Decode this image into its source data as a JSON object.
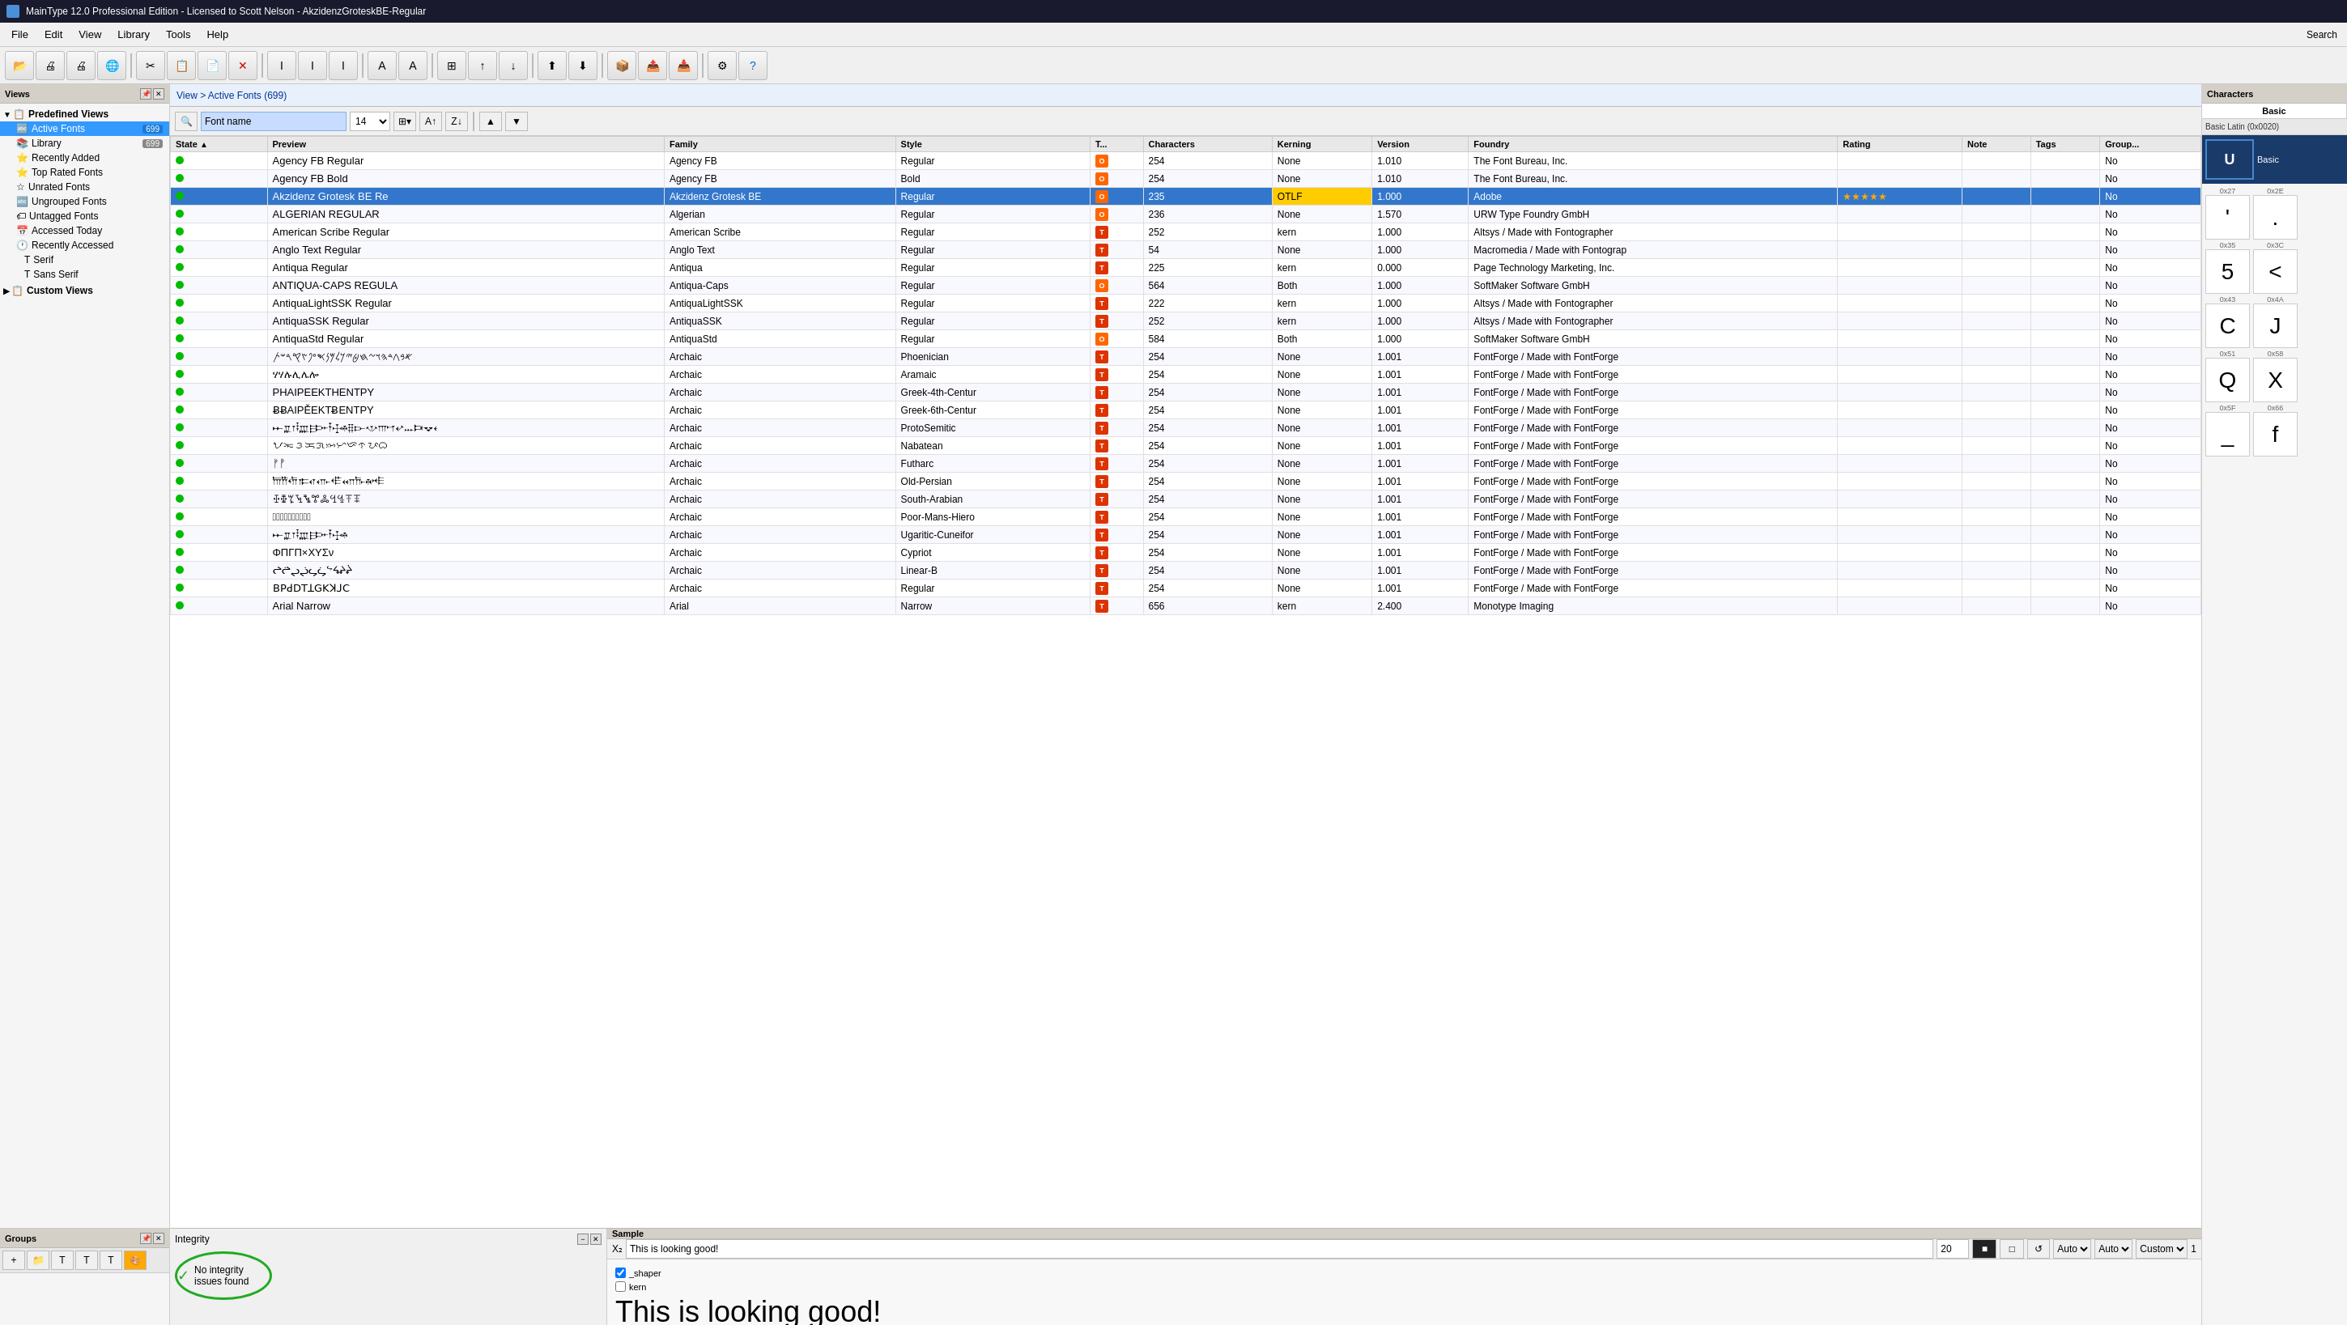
{
  "titleBar": {
    "text": "MainType 12.0 Professional Edition - Licensed to Scott Nelson - AkzidenzGroteskBE-Regular"
  },
  "menuBar": {
    "items": [
      "File",
      "Edit",
      "View",
      "Library",
      "Tools",
      "Help"
    ]
  },
  "toolbar": {
    "searchLabel": "Search"
  },
  "viewsPanel": {
    "title": "Views",
    "predefinedLabel": "Predefined Views",
    "items": [
      {
        "label": "Active Fonts",
        "badge": "699",
        "active": true,
        "icon": "🔤"
      },
      {
        "label": "Library",
        "badge": "699",
        "active": false,
        "icon": "📚"
      },
      {
        "label": "Recently Added",
        "badge": "",
        "active": false,
        "icon": "⭐"
      },
      {
        "label": "Top Rated Fonts",
        "badge": "",
        "active": false,
        "icon": "⭐"
      },
      {
        "label": "Unrated Fonts",
        "badge": "",
        "active": false,
        "icon": "☆"
      },
      {
        "label": "Ungrouped Fonts",
        "badge": "",
        "active": false,
        "icon": "🔤"
      },
      {
        "label": "Untagged Fonts",
        "badge": "",
        "active": false,
        "icon": "🏷"
      },
      {
        "label": "Accessed Today",
        "badge": "",
        "active": false,
        "icon": "📅"
      },
      {
        "label": "Recently Accessed",
        "badge": "",
        "active": false,
        "icon": "🕐"
      },
      {
        "label": "Serif",
        "badge": "",
        "active": false,
        "icon": "T"
      },
      {
        "label": "Sans Serif",
        "badge": "",
        "active": false,
        "icon": "T"
      }
    ],
    "customViewsLabel": "Custom Views"
  },
  "groupsPanel": {
    "title": "Groups"
  },
  "viewPathBar": {
    "text": "View > Active Fonts (699)"
  },
  "fontToolbar": {
    "searchPlaceholder": "Font name",
    "fontSize": "14"
  },
  "tableHeaders": [
    "State",
    "Preview",
    "Family",
    "Style",
    "T...",
    "Characters",
    "Kerning",
    "Version",
    "Foundry",
    "Rating",
    "Note",
    "Tags",
    "Group..."
  ],
  "fonts": [
    {
      "state": "green",
      "preview": "Agency FB Regular",
      "family": "Agency FB",
      "style": "Regular",
      "type": "O",
      "chars": "254",
      "kerning": "None",
      "version": "1.010",
      "foundry": "The Font Bureau, Inc.",
      "rating": "",
      "note": "",
      "tags": "",
      "group": "No",
      "selected": false
    },
    {
      "state": "green",
      "preview": "Agency FB Bold",
      "family": "Agency FB",
      "style": "Bold",
      "type": "O",
      "chars": "254",
      "kerning": "None",
      "version": "1.010",
      "foundry": "The Font Bureau, Inc.",
      "rating": "",
      "note": "",
      "tags": "",
      "group": "No",
      "selected": false
    },
    {
      "state": "green",
      "preview": "Akzidenz Grotesk BE Re",
      "family": "Akzidenz Grotesk BE",
      "style": "Regular",
      "type": "O",
      "chars": "235",
      "kerning": "OTLF",
      "version": "1.000",
      "foundry": "Adobe",
      "rating": "★★★★★",
      "note": "",
      "tags": "",
      "group": "No",
      "selected": true
    },
    {
      "state": "green",
      "preview": "ALGERIAN REGULAR",
      "family": "Algerian",
      "style": "Regular",
      "type": "O",
      "chars": "236",
      "kerning": "None",
      "version": "1.570",
      "foundry": "URW Type Foundry GmbH",
      "rating": "",
      "note": "",
      "tags": "",
      "group": "No",
      "selected": false
    },
    {
      "state": "green",
      "preview": "American Scribe Regular",
      "family": "American Scribe",
      "style": "Regular",
      "type": "T",
      "chars": "252",
      "kerning": "kern",
      "version": "1.000",
      "foundry": "Altsys / Made with Fontographer",
      "rating": "",
      "note": "",
      "tags": "",
      "group": "No",
      "selected": false
    },
    {
      "state": "green",
      "preview": "Anglo Text Regular",
      "family": "Anglo Text",
      "style": "Regular",
      "type": "T",
      "chars": "54",
      "kerning": "None",
      "version": "1.000",
      "foundry": "Macromedia / Made with Fontograp",
      "rating": "",
      "note": "",
      "tags": "",
      "group": "No",
      "selected": false
    },
    {
      "state": "green",
      "preview": "Antiqua Regular",
      "family": "Antiqua",
      "style": "Regular",
      "type": "T",
      "chars": "225",
      "kerning": "kern",
      "version": "0.000",
      "foundry": "Page Technology Marketing, Inc.",
      "rating": "",
      "note": "",
      "tags": "",
      "group": "No",
      "selected": false
    },
    {
      "state": "green",
      "preview": "ANTIQUA-CAPS REGULA",
      "family": "Antiqua-Caps",
      "style": "Regular",
      "type": "O",
      "chars": "564",
      "kerning": "Both",
      "version": "1.000",
      "foundry": "SoftMaker Software GmbH",
      "rating": "",
      "note": "",
      "tags": "",
      "group": "No",
      "selected": false
    },
    {
      "state": "green",
      "preview": "AntiquaLightSSK Regular",
      "family": "AntiquaLightSSK",
      "style": "Regular",
      "type": "T",
      "chars": "222",
      "kerning": "kern",
      "version": "1.000",
      "foundry": "Altsys / Made with Fontographer",
      "rating": "",
      "note": "",
      "tags": "",
      "group": "No",
      "selected": false
    },
    {
      "state": "green",
      "preview": "AntiquaSSK Regular",
      "family": "AntiquaSSK",
      "style": "Regular",
      "type": "T",
      "chars": "252",
      "kerning": "kern",
      "version": "1.000",
      "foundry": "Altsys / Made with Fontographer",
      "rating": "",
      "note": "",
      "tags": "",
      "group": "No",
      "selected": false
    },
    {
      "state": "green",
      "preview": "AntiquaStd Regular",
      "family": "AntiquaStd",
      "style": "Regular",
      "type": "O",
      "chars": "584",
      "kerning": "Both",
      "version": "1.000",
      "foundry": "SoftMaker Software GmbH",
      "rating": "",
      "note": "",
      "tags": "",
      "group": "No",
      "selected": false
    },
    {
      "state": "green",
      "preview": "𐤀𐤁𐤂𐤃𐤄𐤅𐤆𐤇𐤈𐤉𐤊𐤋𐤌𐤍𐤎𐤏𐤐𐤑𐤒𐤓𐤔𐤕",
      "family": "Archaic",
      "style": "Phoenician",
      "type": "T",
      "chars": "254",
      "kerning": "None",
      "version": "1.001",
      "foundry": "FontForge / Made with FontForge",
      "rating": "",
      "note": "",
      "tags": "",
      "group": "No",
      "selected": false
    },
    {
      "state": "green",
      "preview": "ሃሃሉሊሌሎ",
      "family": "Archaic",
      "style": "Aramaic",
      "type": "T",
      "chars": "254",
      "kerning": "None",
      "version": "1.001",
      "foundry": "FontForge / Made with FontForge",
      "rating": "",
      "note": "",
      "tags": "",
      "group": "No",
      "selected": false
    },
    {
      "state": "green",
      "preview": "PHAIPEEKTHENTPY",
      "family": "Archaic",
      "style": "Greek-4th-Centur",
      "type": "T",
      "chars": "254",
      "kerning": "None",
      "version": "1.001",
      "foundry": "FontForge / Made with FontForge",
      "rating": "",
      "note": "",
      "tags": "",
      "group": "No",
      "selected": false
    },
    {
      "state": "green",
      "preview": "ɃɃAIPĚEKΤɃENTPY",
      "family": "Archaic",
      "style": "Greek-6th-Centur",
      "type": "T",
      "chars": "254",
      "kerning": "None",
      "version": "1.001",
      "foundry": "FontForge / Made with FontForge",
      "rating": "",
      "note": "",
      "tags": "",
      "group": "No",
      "selected": false
    },
    {
      "state": "green",
      "preview": "𐎀𐎁𐎂𐎃𐎄𐎅𐎆𐎇𐎈𐎉𐎊𐎋𐎌𐎍𐎎𐎏𐎐𐎑𐎒𐎓",
      "family": "Archaic",
      "style": "ProtoSemitic",
      "type": "T",
      "chars": "254",
      "kerning": "None",
      "version": "1.001",
      "foundry": "FontForge / Made with FontForge",
      "rating": "",
      "note": "",
      "tags": "",
      "group": "No",
      "selected": false
    },
    {
      "state": "green",
      "preview": "ᜀᜁᜂᜃᜄᜅᜆᜇᜈᜉᜊ",
      "family": "Archaic",
      "style": "Nabatean",
      "type": "T",
      "chars": "254",
      "kerning": "None",
      "version": "1.001",
      "foundry": "FontForge / Made with FontForge",
      "rating": "",
      "note": "",
      "tags": "",
      "group": "No",
      "selected": false
    },
    {
      "state": "green",
      "preview": "ᚠᚡ",
      "family": "Archaic",
      "style": "Futharc",
      "type": "T",
      "chars": "254",
      "kerning": "None",
      "version": "1.001",
      "foundry": "FontForge / Made with FontForge",
      "rating": "",
      "note": "",
      "tags": "",
      "group": "No",
      "selected": false
    },
    {
      "state": "green",
      "preview": "𐎠𐎡𐎢𐎣𐎤𐎥𐎦𐎧𐎨𐎩𐎪",
      "family": "Archaic",
      "style": "Old-Persian",
      "type": "T",
      "chars": "254",
      "kerning": "None",
      "version": "1.001",
      "foundry": "FontForge / Made with FontForge",
      "rating": "",
      "note": "",
      "tags": "",
      "group": "No",
      "selected": false
    },
    {
      "state": "green",
      "preview": "ꔀꔁꔂꔃꔄꔅꔆꔇꔈꔉꔊ",
      "family": "Archaic",
      "style": "South-Arabian",
      "type": "T",
      "chars": "254",
      "kerning": "None",
      "version": "1.001",
      "foundry": "FontForge / Made with FontForge",
      "rating": "",
      "note": "",
      "tags": "",
      "group": "No",
      "selected": false
    },
    {
      "state": "green",
      "preview": "𓀀𓀁𓂀𓄿𓆄𓇋𓇯𓈎𓉐𓊪",
      "family": "Archaic",
      "style": "Poor-Mans-Hiero",
      "type": "T",
      "chars": "254",
      "kerning": "None",
      "version": "1.001",
      "foundry": "FontForge / Made with FontForge",
      "rating": "",
      "note": "",
      "tags": "",
      "group": "No",
      "selected": false
    },
    {
      "state": "green",
      "preview": "𐎀𐎁𐎂𐎃𐎄𐎅𐎆𐎇𐎈𐎉",
      "family": "Archaic",
      "style": "Ugaritic-Cuneifor",
      "type": "T",
      "chars": "254",
      "kerning": "None",
      "version": "1.001",
      "foundry": "FontForge / Made with FontForge",
      "rating": "",
      "note": "",
      "tags": "",
      "group": "No",
      "selected": false
    },
    {
      "state": "green",
      "preview": "ΦΠΓΠ×ΧΥΣν",
      "family": "Archaic",
      "style": "Cypriot",
      "type": "T",
      "chars": "254",
      "kerning": "None",
      "version": "1.001",
      "foundry": "FontForge / Made with FontForge",
      "rating": "",
      "note": "",
      "tags": "",
      "group": "No",
      "selected": false
    },
    {
      "state": "green",
      "preview": "ᖠᖡᖢᖣᖤᖥᖦᖧᖨᖩ",
      "family": "Archaic",
      "style": "Linear-B",
      "type": "T",
      "chars": "254",
      "kerning": "None",
      "version": "1.001",
      "foundry": "FontForge / Made with FontForge",
      "rating": "",
      "note": "",
      "tags": "",
      "group": "No",
      "selected": false
    },
    {
      "state": "green",
      "preview": "ꓐꓑꓒꓓꓔꓕꓖꓗꓘꓙꓚ",
      "family": "Archaic",
      "style": "Regular",
      "type": "T",
      "chars": "254",
      "kerning": "None",
      "version": "1.001",
      "foundry": "FontForge / Made with FontForge",
      "rating": "",
      "note": "",
      "tags": "",
      "group": "No",
      "selected": false
    },
    {
      "state": "green",
      "preview": "Arial Narrow",
      "family": "Arial",
      "style": "Narrow",
      "type": "T",
      "chars": "656",
      "kerning": "kern",
      "version": "2.400",
      "foundry": "Monotype Imaging",
      "rating": "",
      "note": "",
      "tags": "",
      "group": "No",
      "selected": false
    }
  ],
  "integrityPanel": {
    "title": "Integrity",
    "message": "No integrity issues found"
  },
  "samplePanel": {
    "title": "Sample",
    "subscriptLabel": "X₂",
    "textValue": "This is looking good!",
    "fontSize": "20",
    "bigText": "This is looking good!",
    "checkboxes": [
      {
        "label": "_shaper",
        "checked": true
      },
      {
        "label": "kern",
        "checked": false
      }
    ],
    "autoLabel1": "Auto",
    "autoLabel2": "Auto",
    "customLabel": "Custom"
  },
  "charactersPanel": {
    "title": "Characters",
    "tabs": [
      {
        "label": "Basic",
        "active": true
      }
    ],
    "subtitle": "Basic Latin (0x0020)",
    "chars": [
      {
        "code": "0x27",
        "symbol": "'",
        "code2": "0x2E",
        "symbol2": "."
      },
      {
        "code": "0x35",
        "symbol": "5",
        "code2": "0x3C",
        "symbol2": "<"
      },
      {
        "code": "0x43",
        "symbol": "C",
        "code2": "0x4A",
        "symbol2": "J"
      },
      {
        "code": "0x51",
        "symbol": "Q",
        "code2": "0x58",
        "symbol2": "X"
      },
      {
        "code": "0x5F",
        "symbol": "_",
        "code2": "0x66",
        "symbol2": "f"
      }
    ]
  }
}
